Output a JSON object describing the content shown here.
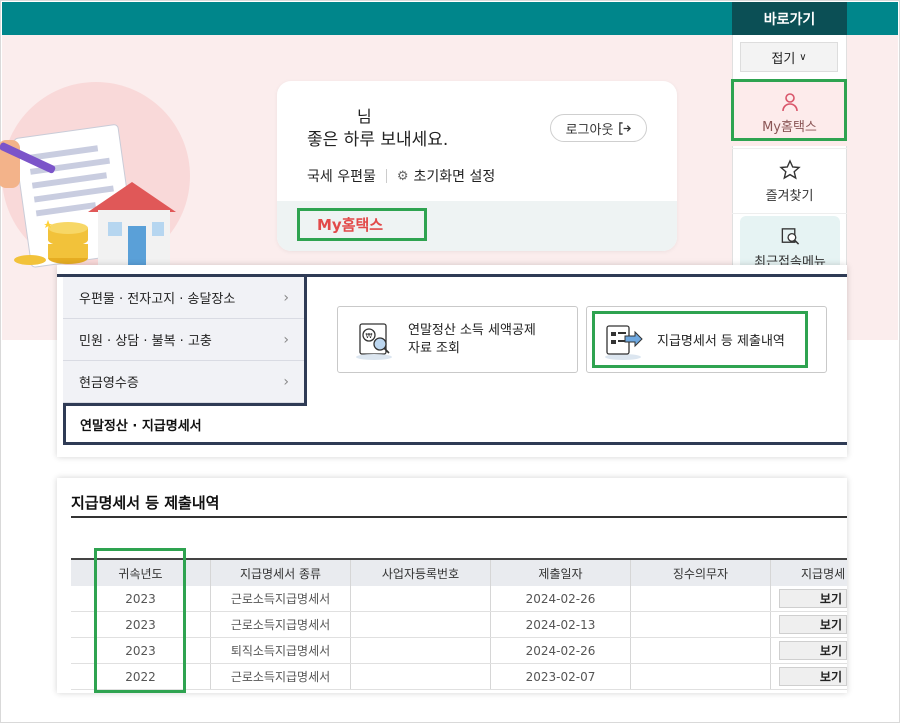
{
  "header": {
    "quick_title": "바로가기"
  },
  "welcome": {
    "name_suffix": "님",
    "greeting": "좋은 하루 보내세요.",
    "logout_label": "로그아웃",
    "links": [
      "국세 우편물",
      "초기화면 설정"
    ],
    "my_hometax": "My홈택스"
  },
  "quick_panel": {
    "fold_label": "접기",
    "items": [
      "My홈택스",
      "즐겨찾기",
      "최근접속메뉴"
    ]
  },
  "menu": {
    "left_items": [
      "우편물 · 전자고지 · 송달장소",
      "민원 · 상담 · 불복 · 고충",
      "현금영수증"
    ],
    "active_item": "연말정산 · 지급명세서",
    "cards": {
      "card1_line1": "연말정산 소득 세액공제",
      "card1_line2": "자료 조회",
      "card2": "지급명세서 등 제출내역"
    }
  },
  "table": {
    "title": "지급명세서 등 제출내역",
    "headers": [
      "귀속년도",
      "지급명세서 종류",
      "사업자등록번호",
      "제출일자",
      "징수의무자",
      "지급명세"
    ],
    "rows": [
      {
        "year": "2023",
        "type": "근로소득지급명세서",
        "bizno": "",
        "date": "2024-02-26",
        "payer": "",
        "view": "보기"
      },
      {
        "year": "2023",
        "type": "근로소득지급명세서",
        "bizno": "",
        "date": "2024-02-13",
        "payer": "",
        "view": "보기"
      },
      {
        "year": "2023",
        "type": "퇴직소득지급명세서",
        "bizno": "",
        "date": "2024-02-26",
        "payer": "",
        "view": "보기"
      },
      {
        "year": "2022",
        "type": "근로소득지급명세서",
        "bizno": "",
        "date": "2023-02-07",
        "payer": "",
        "view": "보기"
      }
    ]
  },
  "colors": {
    "topbar": "#00868b",
    "quick_head": "#0b4f55",
    "highlight": "#2ea350",
    "accent_red": "#e24a4a",
    "menu_navy": "#2f3b55"
  }
}
